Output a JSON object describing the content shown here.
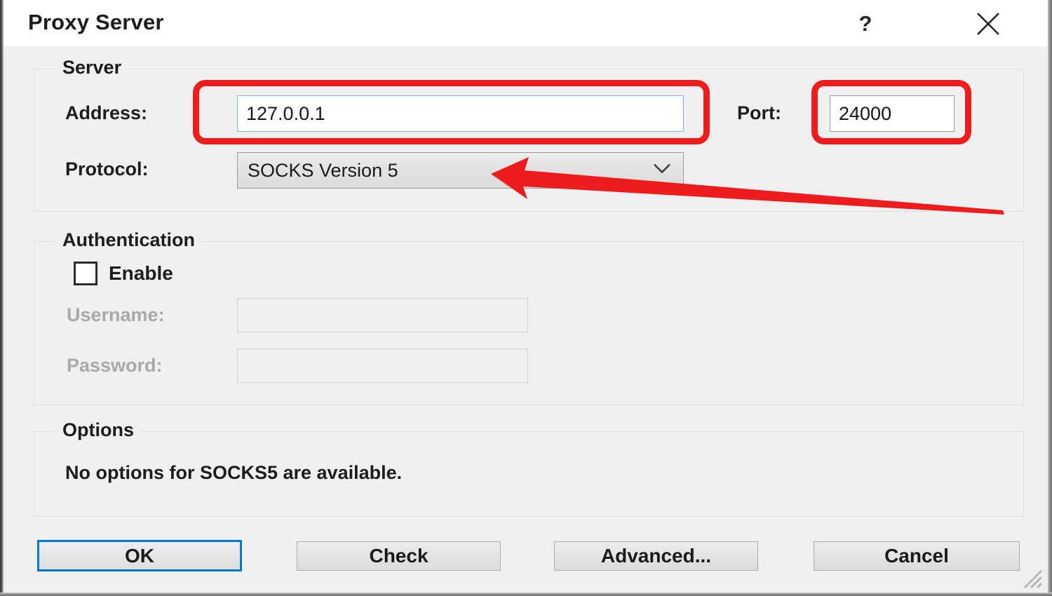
{
  "window": {
    "title": "Proxy Server",
    "help_icon": "question-mark-icon",
    "close_icon": "close-x-icon"
  },
  "server_group": {
    "legend": "Server",
    "address_label": "Address:",
    "address_value": "127.0.0.1",
    "port_label": "Port:",
    "port_value": "24000",
    "protocol_label": "Protocol:",
    "protocol_value": "SOCKS Version 5",
    "protocol_arrow_icon": "chevron-down-icon"
  },
  "auth_group": {
    "legend": "Authentication",
    "enable_label": "Enable",
    "enable_checked": false,
    "username_label": "Username:",
    "username_value": "",
    "password_label": "Password:",
    "password_value": ""
  },
  "options_group": {
    "legend": "Options",
    "message": "No options for SOCKS5 are available."
  },
  "buttons": {
    "ok": "OK",
    "check": "Check",
    "advanced": "Advanced...",
    "cancel": "Cancel"
  },
  "annotations": {
    "highlight_color": "#ee1c1c",
    "arrow_color": "#ee1c1c",
    "arrow_points_to": "protocol-combobox"
  },
  "colors": {
    "dialog_background": "#f0f0f0",
    "titlebar_background": "#ffffff",
    "focus_border": "#0078d7",
    "input_focus_border": "#7eb4ea",
    "text": "#1d1d1d",
    "disabled_text": "#a9a9a9"
  }
}
